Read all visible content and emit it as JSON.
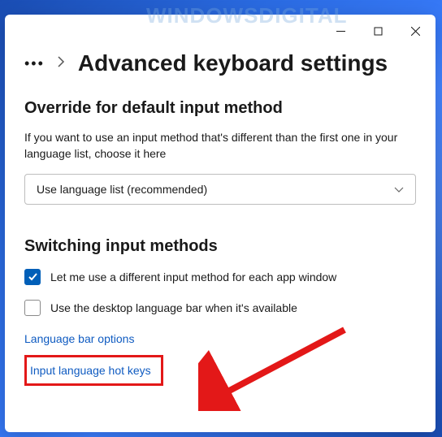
{
  "watermark": "WindowsDigital",
  "breadcrumb": {
    "title": "Advanced keyboard settings"
  },
  "section1": {
    "heading": "Override for default input method",
    "description": "If you want to use an input method that's different than the first one in your language list, choose it here",
    "dropdown_value": "Use language list (recommended)"
  },
  "section2": {
    "heading": "Switching input methods",
    "check1_label": "Let me use a different input method for each app window",
    "check1_checked": true,
    "check2_label": "Use the desktop language bar when it's available",
    "check2_checked": false,
    "link1": "Language bar options",
    "link2": "Input language hot keys"
  }
}
